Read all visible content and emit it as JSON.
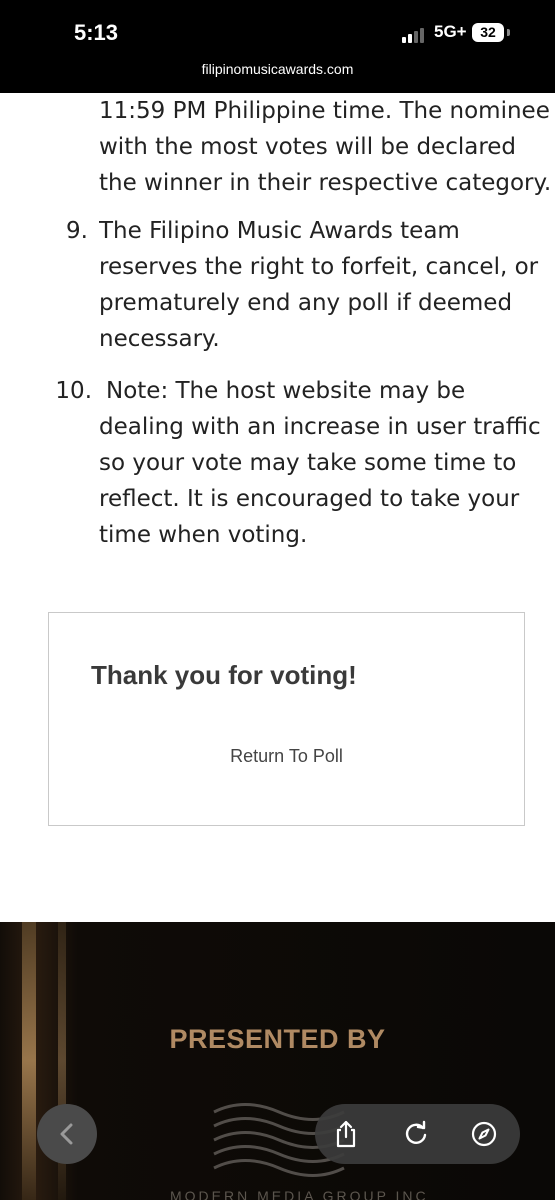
{
  "status_bar": {
    "time": "5:13",
    "network": "5G+",
    "battery": "32"
  },
  "browser": {
    "url": "filipinomusicawards.com"
  },
  "rules": {
    "item8_lines": [
      "11:59 PM Philippine time. The nominee",
      "with the most votes will be declared",
      "the winner in their respective category."
    ],
    "item9": {
      "number": "9.",
      "lines": [
        "The Filipino Music Awards team",
        "reserves the right to forfeit, cancel, or",
        "prematurely end any poll if deemed",
        "necessary."
      ]
    },
    "item10": {
      "number": "10.",
      "lines": [
        "Note: The host website may be",
        "dealing with an increase in user traffic",
        "so your vote may take some time to",
        "reflect. It is encouraged to take your",
        "time when voting."
      ]
    }
  },
  "poll": {
    "thanks_title": "Thank you for voting!",
    "return_label": "Return To Poll"
  },
  "footer": {
    "presented_by": "PRESENTED BY",
    "logo_text": "MODERN MEDIA GROUP INC"
  },
  "toolbar": {
    "back_icon": "chevron-left-icon",
    "share_icon": "share-icon",
    "reload_icon": "reload-icon",
    "compass_icon": "compass-icon"
  }
}
